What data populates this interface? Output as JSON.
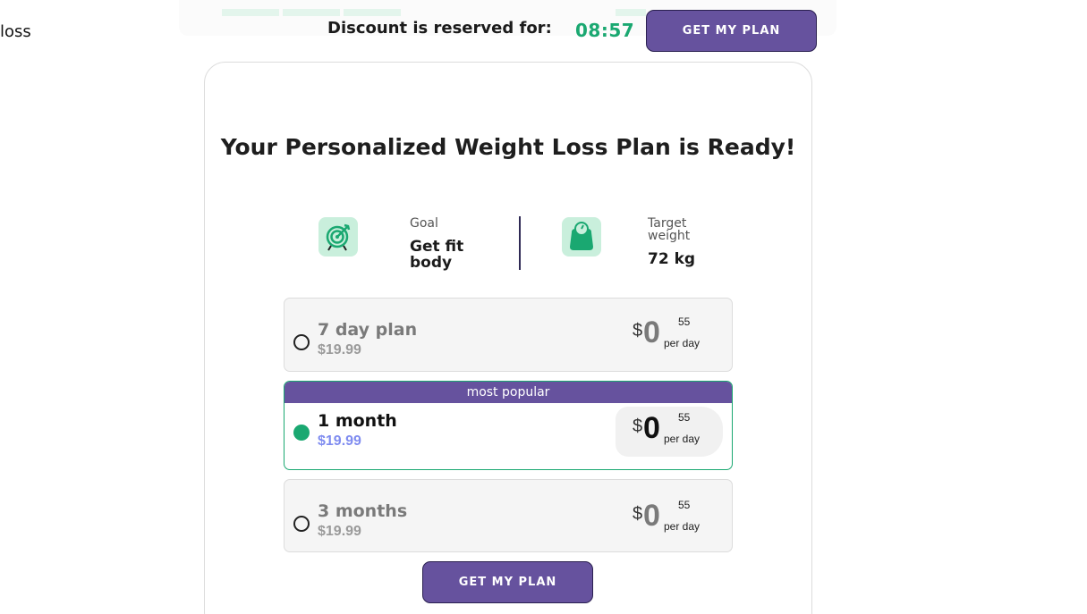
{
  "header": {
    "loss_fragment": "loss",
    "discount_label": "Discount is reserved for:",
    "timer": "08:57",
    "cta_label": "GET MY PLAN"
  },
  "main": {
    "title": "Your Personalized Weight Loss Plan is Ready!",
    "goal": {
      "caption": "Goal",
      "value": "Get fit body",
      "icon": "target-icon"
    },
    "target": {
      "caption": "Target weight",
      "value": "72 kg",
      "icon": "scale-icon"
    }
  },
  "plans": [
    {
      "name": "7 day plan",
      "price": "$19.99",
      "currency": "$",
      "big": "0",
      "cents": "55",
      "per": "per day",
      "selected": false,
      "badge": ""
    },
    {
      "name": "1 month",
      "price": "$19.99",
      "currency": "$",
      "big": "0",
      "cents": "55",
      "per": "per day",
      "selected": true,
      "badge": "most popular"
    },
    {
      "name": "3 months",
      "price": "$19.99",
      "currency": "$",
      "big": "0",
      "cents": "55",
      "per": "per day",
      "selected": false,
      "badge": ""
    }
  ],
  "footer": {
    "cta_label": "GET MY PLAN"
  },
  "colors": {
    "accent": "#66529e",
    "green": "#1aa871",
    "badge_bg": "#66529e",
    "price_selected": "#7f8cf0"
  }
}
